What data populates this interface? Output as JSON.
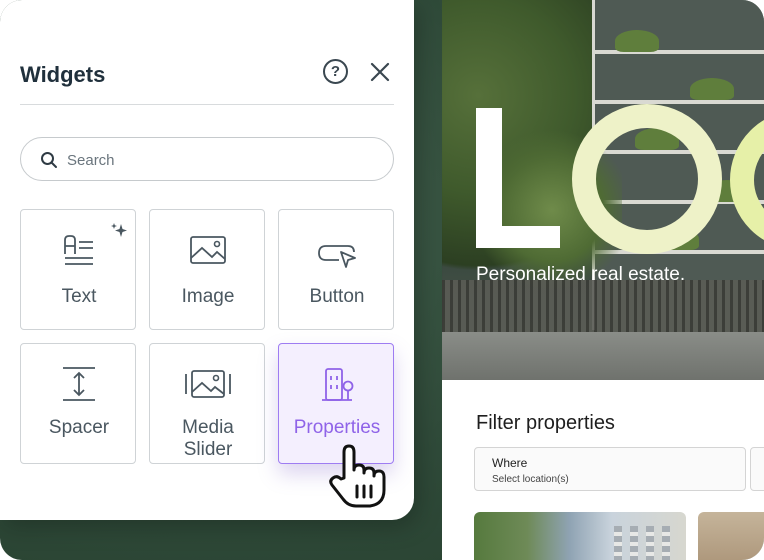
{
  "panel": {
    "title": "Widgets",
    "help_icon": "help-circle-icon",
    "close_icon": "close-icon",
    "search": {
      "placeholder": "Search",
      "value": ""
    },
    "widgets": [
      {
        "label": "Text",
        "icon": "text-icon",
        "badge_icon": "ai-sparkle-icon"
      },
      {
        "label": "Image",
        "icon": "image-icon"
      },
      {
        "label": "Button",
        "icon": "button-cursor-icon"
      },
      {
        "label": "Spacer",
        "icon": "spacer-icon"
      },
      {
        "label": "Media Slider",
        "icon": "media-slider-icon"
      },
      {
        "label": "Properties",
        "icon": "properties-icon",
        "state": "hover"
      }
    ],
    "accent_color": "#8f63e8"
  },
  "preview": {
    "logo_text": "LO",
    "tagline": "Personalized real estate.",
    "filter_title": "Filter properties",
    "where_label": "Where",
    "where_value": "Select location(s)"
  },
  "cursor_icon": "drag-hand-cursor-icon"
}
